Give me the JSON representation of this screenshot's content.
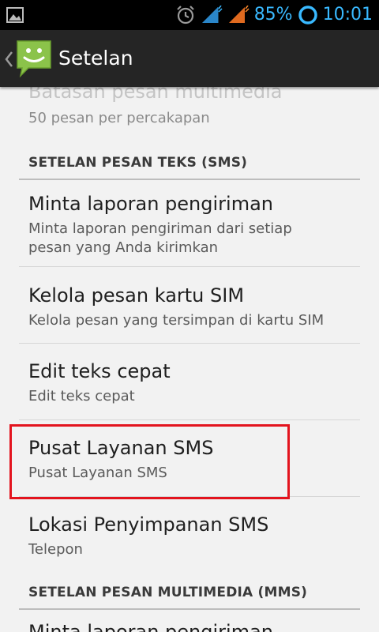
{
  "status_bar": {
    "battery_percent": "85%",
    "time": "10:01",
    "accent_color": "#39b9ff"
  },
  "action_bar": {
    "title": "Setelan"
  },
  "sections": {
    "mms_limit": {
      "title": "Batasan pesan multimedia",
      "summary": "50 pesan per percakapan"
    },
    "sms_header": "SETELAN PESAN TEKS (SMS)",
    "delivery_report": {
      "title": "Minta laporan pengiriman",
      "summary": "Minta laporan pengiriman dari setiap pesan yang Anda kirimkan"
    },
    "sim_messages": {
      "title": "Kelola pesan kartu SIM",
      "summary": "Kelola pesan yang tersimpan di kartu SIM"
    },
    "quick_text": {
      "title": "Edit teks cepat",
      "summary": "Edit teks cepat"
    },
    "sms_center": {
      "title": "Pusat Layanan SMS",
      "summary": "Pusat Layanan SMS"
    },
    "sms_storage": {
      "title": "Lokasi Penyimpanan SMS",
      "summary": "Telepon"
    },
    "mms_header": "SETELAN PESAN MULTIMEDIA (MMS)",
    "mms_delivery_report": {
      "title": "Minta laporan pengiriman"
    }
  },
  "highlight_color": "#e3141e"
}
